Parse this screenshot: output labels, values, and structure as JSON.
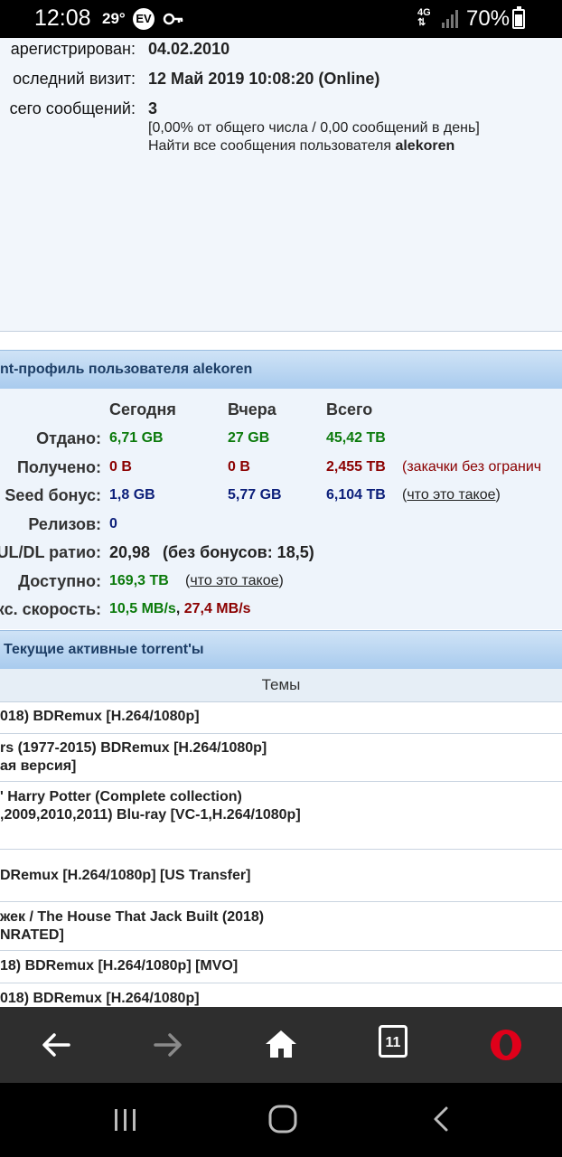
{
  "status_bar": {
    "time": "12:08",
    "temperature": "29°",
    "ev_badge": "EV",
    "network": "4G",
    "battery": "70%"
  },
  "profile": {
    "registered_label": "арегистрирован:",
    "registered_value": "04.02.2010",
    "last_visit_label": "оследний визит:",
    "last_visit_value": "12 Май 2019 10:08:20 (Online)",
    "posts_label": "сего сообщений:",
    "posts_value": "3",
    "posts_note": "[0,00% от общего числа / 0,00 сообщений в день]",
    "find_posts_text": "Найти все сообщения пользователя",
    "find_posts_user": "alekoren"
  },
  "torrent_profile": {
    "section_title": "nt-профиль пользователя alekoren",
    "columns": [
      "Сегодня",
      "Вчера",
      "Всего"
    ],
    "rows": {
      "uploaded": {
        "label": "Отдано:",
        "today": "6,71 GB",
        "yesterday": "27 GB",
        "total": "45,42 TB"
      },
      "downloaded": {
        "label": "Получено:",
        "today": "0 B",
        "yesterday": "0 B",
        "total": "2,455 TB",
        "note": "(закачки без огранич"
      },
      "seed_bonus": {
        "label": "Seed бонус:",
        "today": "1,8 GB",
        "yesterday": "5,77 GB",
        "total": "6,104 TB",
        "note_open": "(",
        "note_link": "что это такое",
        "note_close": ")"
      },
      "releases": {
        "label": "Релизов:",
        "value": "0"
      },
      "ratio": {
        "label": "UL/DL ратио:",
        "value": "20,98",
        "note": "(без бонусов: 18,5)"
      },
      "available": {
        "label": "Доступно:",
        "value": "169,3 TB",
        "note_open": "(",
        "note_link": "что это такое",
        "note_close": ")"
      },
      "max_speed": {
        "label": "кс. скорость:",
        "up": "10,5 MB/s",
        "sep": ",",
        "down": "27,4 MB/s"
      }
    }
  },
  "active_torrents": {
    "section_title": "Текущие активные torrent'ы",
    "column_header": "Темы",
    "items": [
      {
        "line1": "018) BDRemux [H.264/1080p]",
        "line2": ""
      },
      {
        "line1": "rs (1977-2015) BDRemux [H.264/1080p]",
        "line2": "ая версия]"
      },
      {
        "line1": "' Harry Potter (Complete collection)",
        "line2": ",2009,2010,2011) Blu-ray [VC-1,H.264/1080p]"
      },
      {
        "line1": "DRemux [H.264/1080p] [US Transfer]",
        "line2": ""
      },
      {
        "line1": "жек / The House That Jack Built (2018)",
        "line2": "NRATED]"
      },
      {
        "line1": "18) BDRemux [H.264/1080p] [MVO]",
        "line2": ""
      },
      {
        "line1": "018) BDRemux [H.264/1080p]",
        "line2": ""
      }
    ]
  },
  "browser_nav": {
    "tabs_count": "11",
    "icons": [
      "back-icon",
      "forward-icon",
      "home-icon",
      "tabs-icon",
      "opera-icon"
    ]
  },
  "system_nav": {
    "icons": [
      "recents-icon",
      "home-circle-icon",
      "back-chevron-icon"
    ]
  }
}
